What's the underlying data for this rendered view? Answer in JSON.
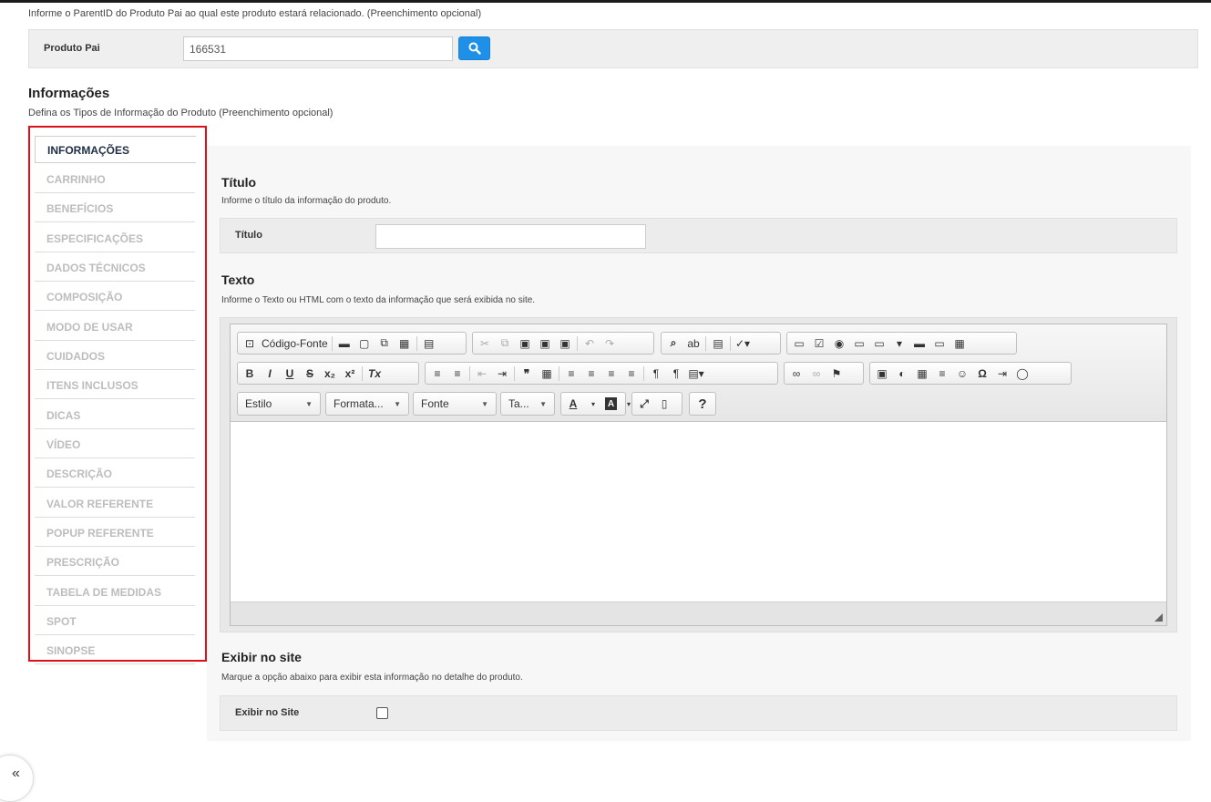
{
  "intro_text": "Informe o ParentID do Produto Pai ao qual este produto estará relacionado. (Preenchimento opcional)",
  "parent": {
    "label": "Produto Pai",
    "value": "166531",
    "search_icon": "search-icon"
  },
  "section": {
    "title": "Informações",
    "subtitle": "Defina os Tipos de Informação do Produto (Preenchimento opcional)"
  },
  "tabs": [
    {
      "label": "INFORMAÇÕES",
      "active": true
    },
    {
      "label": "CARRINHO"
    },
    {
      "label": "BENEFÍCIOS"
    },
    {
      "label": "ESPECIFICAÇÕES"
    },
    {
      "label": "DADOS TÉCNICOS"
    },
    {
      "label": "COMPOSIÇÃO"
    },
    {
      "label": "MODO DE USAR"
    },
    {
      "label": "CUIDADOS"
    },
    {
      "label": "ITENS INCLUSOS"
    },
    {
      "label": "DICAS"
    },
    {
      "label": "VÍDEO"
    },
    {
      "label": "DESCRIÇÃO"
    },
    {
      "label": "VALOR REFERENTE"
    },
    {
      "label": "POPUP REFERENTE"
    },
    {
      "label": "PRESCRIÇÃO"
    },
    {
      "label": "TABELA DE MEDIDAS"
    },
    {
      "label": "SPOT"
    },
    {
      "label": "SINOPSE"
    }
  ],
  "titulo": {
    "heading": "Título",
    "hint": "Informe o título da informação do produto.",
    "label": "Título",
    "value": ""
  },
  "texto": {
    "heading": "Texto",
    "hint": "Informe o Texto ou HTML com o texto da informação que será exibida no site."
  },
  "editor": {
    "source_label": "Código-Fonte",
    "combos": {
      "style": "Estilo",
      "format": "Formata...",
      "font": "Fonte",
      "size": "Ta..."
    },
    "help_label": "?",
    "text_color_label": "A",
    "bg_color_label": "A",
    "omega": "Ω"
  },
  "exibir": {
    "heading": "Exibir no site",
    "hint": "Marque a opção abaixo para exibir esta informação no detalhe do produto.",
    "label": "Exibir no Site",
    "checked": false
  },
  "collapse_label": "«"
}
